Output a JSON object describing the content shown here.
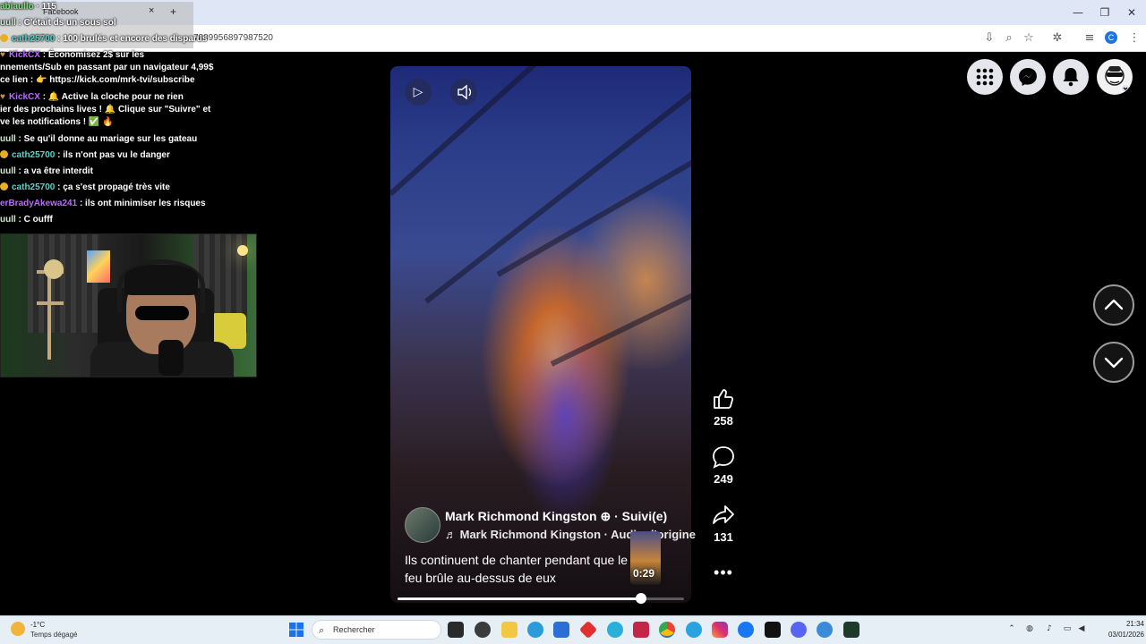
{
  "browser": {
    "tab_title": "Facebook",
    "tab_close": "×",
    "tab_new": "+",
    "url_fragment": "7889956897987520",
    "profile_initial": "C",
    "window_controls": [
      "—",
      "❐",
      "✕"
    ]
  },
  "chat": {
    "lines": [
      {
        "user": "abiaullo",
        "text": " · 115"
      },
      {
        "user": "uull",
        "text": " : C'était ds un sous sol"
      },
      {
        "user": "cath25700",
        "text": " : 100 brulés et encore des disparus"
      },
      {
        "user": "KickCX",
        "text": " : Économisez 2$ sur les"
      },
      {
        "user": "",
        "text": "nnements/Sub en passant par un navigateur 4,99$"
      },
      {
        "user": "",
        "text": "ce lien : 👉 https://kick.com/mrk-tvi/subscribe"
      },
      {
        "user": "KickCX",
        "text": " : 🔔 Active la cloche pour ne rien"
      },
      {
        "user": "",
        "text": "ier des prochains lives ! 🔔 Clique sur \"Suivre\" et"
      },
      {
        "user": "",
        "text": "ve les notifications ! ✅ 🔥"
      },
      {
        "user": "uull",
        "text": " : Se qu'il donne au mariage sur les gateau"
      },
      {
        "user": "cath25700",
        "text": " : ils n'ont pas vu le danger"
      },
      {
        "user": "uull",
        "text": " : a va être interdit"
      },
      {
        "user": "cath25700",
        "text": " : ça s'est propagé très vite"
      },
      {
        "user": "erBradyAkewa241",
        "text": " : ils ont minimiser les risques"
      },
      {
        "user": "uull",
        "text": " : C oufff"
      }
    ]
  },
  "video": {
    "author": "Mark Richmond Kingston",
    "author_suffix": " ⊕ · Suivi(e)",
    "audio": "♬ Mark Richmond Kingston · Audio d'origine",
    "caption": "Ils continuent de chanter pendant que le feu brûle au-dessus de eux",
    "time": "0:29",
    "progress_fraction": 0.85
  },
  "actions": {
    "likes": "258",
    "comments": "249",
    "shares": "131",
    "more": "•••"
  },
  "taskbar": {
    "temp": "-1°C",
    "weather": "Temps dégagé",
    "search_placeholder": "Rechercher",
    "time": "21:34",
    "date": "03/01/2026"
  },
  "colors": {
    "accent": "#1a73e8",
    "taskbar_bg": "#e6eef6"
  }
}
